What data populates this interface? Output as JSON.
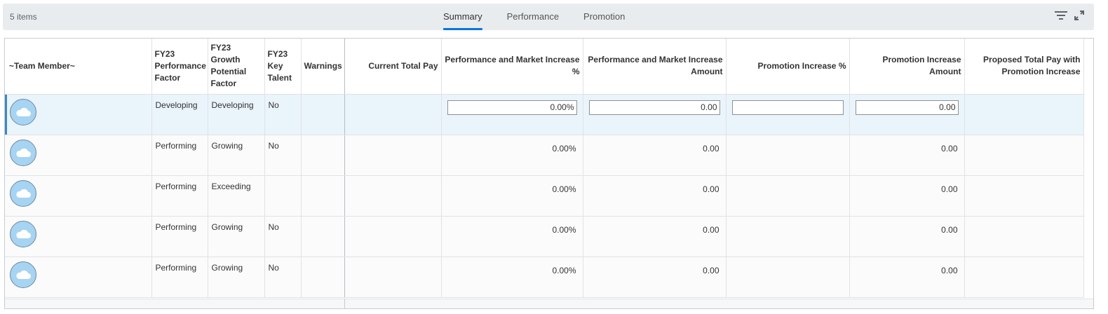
{
  "toolbar": {
    "item_count": "5 items",
    "tabs": [
      {
        "label": "Summary",
        "active": true
      },
      {
        "label": "Performance",
        "active": false
      },
      {
        "label": "Promotion",
        "active": false
      }
    ],
    "icons": [
      "filter-icon",
      "expand-icon"
    ]
  },
  "columns": {
    "team_member": "~Team Member~",
    "performance_factor": "FY23 Performance Factor",
    "growth_factor": "FY23 Growth Potential Factor",
    "key_talent": "FY23 Key Talent",
    "warnings": "Warnings",
    "current_total_pay": "Current Total Pay",
    "market_increase_pct": "Performance and Market Increase %",
    "market_increase_amt": "Performance and Market Increase Amount",
    "promotion_pct": "Promotion Increase %",
    "promotion_amt": "Promotion Increase Amount",
    "proposed_total": "Proposed Total Pay with Promotion Increase"
  },
  "rows": [
    {
      "performance": "Developing",
      "growth": "Developing",
      "key_talent": "No",
      "market_pct": "0.00%",
      "market_amt": "0.00",
      "promotion_pct": "",
      "promotion_amt": "0.00",
      "selected": true
    },
    {
      "performance": "Performing",
      "growth": "Growing",
      "key_talent": "No",
      "market_pct": "0.00%",
      "market_amt": "0.00",
      "promotion_pct": "",
      "promotion_amt": "0.00",
      "selected": false
    },
    {
      "performance": "Performing",
      "growth": "Exceeding",
      "key_talent": "",
      "market_pct": "0.00%",
      "market_amt": "0.00",
      "promotion_pct": "",
      "promotion_amt": "0.00",
      "selected": false
    },
    {
      "performance": "Performing",
      "growth": "Growing",
      "key_talent": "No",
      "market_pct": "0.00%",
      "market_amt": "0.00",
      "promotion_pct": "",
      "promotion_amt": "0.00",
      "selected": false
    },
    {
      "performance": "Performing",
      "growth": "Growing",
      "key_talent": "No",
      "market_pct": "0.00%",
      "market_amt": "0.00",
      "promotion_pct": "",
      "promotion_amt": "0.00",
      "selected": false
    }
  ],
  "colors": {
    "accent": "#0875e1",
    "avatar": "#a6d4f2",
    "selected_row": "#eaf4fb"
  }
}
